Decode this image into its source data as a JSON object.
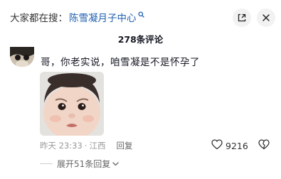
{
  "search": {
    "prefix": "大家都在搜：",
    "keyword": "陈雪凝月子中心",
    "icon": "search-icon"
  },
  "header": {
    "comment_count": "278条评论",
    "expand_icon": "expand-icon",
    "close_icon": "close-icon"
  },
  "comment": {
    "text": "哥，你老实说，咱雪凝是不是怀孕了",
    "time": "昨天 23:33",
    "location": "江西",
    "reply_label": "回复",
    "like_count": "9216",
    "like_icon": "heart-icon",
    "dislike_icon": "broken-heart-icon"
  },
  "replies": {
    "expand_label": "展开51条回复",
    "chevron_icon": "chevron-down-icon"
  },
  "colors": {
    "keyword": "#1f5fb0",
    "text": "#161823",
    "meta": "#999999"
  }
}
